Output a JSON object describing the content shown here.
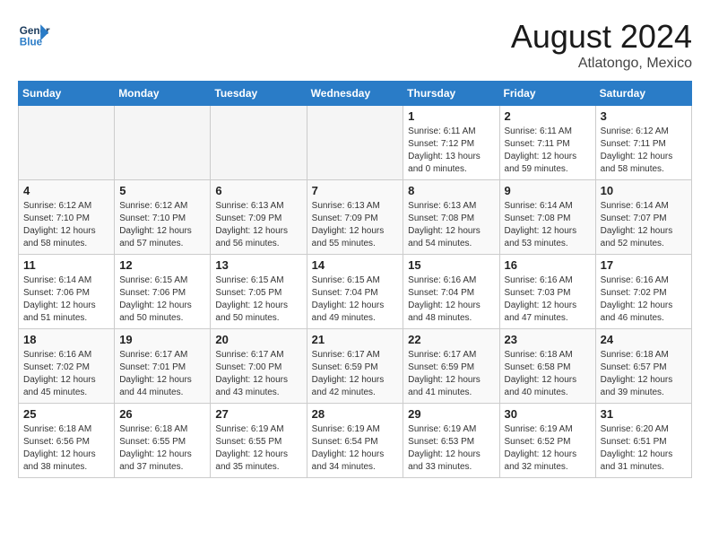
{
  "header": {
    "logo_line1": "General",
    "logo_line2": "Blue",
    "month": "August 2024",
    "location": "Atlatongo, Mexico"
  },
  "days_of_week": [
    "Sunday",
    "Monday",
    "Tuesday",
    "Wednesday",
    "Thursday",
    "Friday",
    "Saturday"
  ],
  "weeks": [
    [
      {
        "day": "",
        "info": ""
      },
      {
        "day": "",
        "info": ""
      },
      {
        "day": "",
        "info": ""
      },
      {
        "day": "",
        "info": ""
      },
      {
        "day": "1",
        "info": "Sunrise: 6:11 AM\nSunset: 7:12 PM\nDaylight: 13 hours\nand 0 minutes."
      },
      {
        "day": "2",
        "info": "Sunrise: 6:11 AM\nSunset: 7:11 PM\nDaylight: 12 hours\nand 59 minutes."
      },
      {
        "day": "3",
        "info": "Sunrise: 6:12 AM\nSunset: 7:11 PM\nDaylight: 12 hours\nand 58 minutes."
      }
    ],
    [
      {
        "day": "4",
        "info": "Sunrise: 6:12 AM\nSunset: 7:10 PM\nDaylight: 12 hours\nand 58 minutes."
      },
      {
        "day": "5",
        "info": "Sunrise: 6:12 AM\nSunset: 7:10 PM\nDaylight: 12 hours\nand 57 minutes."
      },
      {
        "day": "6",
        "info": "Sunrise: 6:13 AM\nSunset: 7:09 PM\nDaylight: 12 hours\nand 56 minutes."
      },
      {
        "day": "7",
        "info": "Sunrise: 6:13 AM\nSunset: 7:09 PM\nDaylight: 12 hours\nand 55 minutes."
      },
      {
        "day": "8",
        "info": "Sunrise: 6:13 AM\nSunset: 7:08 PM\nDaylight: 12 hours\nand 54 minutes."
      },
      {
        "day": "9",
        "info": "Sunrise: 6:14 AM\nSunset: 7:08 PM\nDaylight: 12 hours\nand 53 minutes."
      },
      {
        "day": "10",
        "info": "Sunrise: 6:14 AM\nSunset: 7:07 PM\nDaylight: 12 hours\nand 52 minutes."
      }
    ],
    [
      {
        "day": "11",
        "info": "Sunrise: 6:14 AM\nSunset: 7:06 PM\nDaylight: 12 hours\nand 51 minutes."
      },
      {
        "day": "12",
        "info": "Sunrise: 6:15 AM\nSunset: 7:06 PM\nDaylight: 12 hours\nand 50 minutes."
      },
      {
        "day": "13",
        "info": "Sunrise: 6:15 AM\nSunset: 7:05 PM\nDaylight: 12 hours\nand 50 minutes."
      },
      {
        "day": "14",
        "info": "Sunrise: 6:15 AM\nSunset: 7:04 PM\nDaylight: 12 hours\nand 49 minutes."
      },
      {
        "day": "15",
        "info": "Sunrise: 6:16 AM\nSunset: 7:04 PM\nDaylight: 12 hours\nand 48 minutes."
      },
      {
        "day": "16",
        "info": "Sunrise: 6:16 AM\nSunset: 7:03 PM\nDaylight: 12 hours\nand 47 minutes."
      },
      {
        "day": "17",
        "info": "Sunrise: 6:16 AM\nSunset: 7:02 PM\nDaylight: 12 hours\nand 46 minutes."
      }
    ],
    [
      {
        "day": "18",
        "info": "Sunrise: 6:16 AM\nSunset: 7:02 PM\nDaylight: 12 hours\nand 45 minutes."
      },
      {
        "day": "19",
        "info": "Sunrise: 6:17 AM\nSunset: 7:01 PM\nDaylight: 12 hours\nand 44 minutes."
      },
      {
        "day": "20",
        "info": "Sunrise: 6:17 AM\nSunset: 7:00 PM\nDaylight: 12 hours\nand 43 minutes."
      },
      {
        "day": "21",
        "info": "Sunrise: 6:17 AM\nSunset: 6:59 PM\nDaylight: 12 hours\nand 42 minutes."
      },
      {
        "day": "22",
        "info": "Sunrise: 6:17 AM\nSunset: 6:59 PM\nDaylight: 12 hours\nand 41 minutes."
      },
      {
        "day": "23",
        "info": "Sunrise: 6:18 AM\nSunset: 6:58 PM\nDaylight: 12 hours\nand 40 minutes."
      },
      {
        "day": "24",
        "info": "Sunrise: 6:18 AM\nSunset: 6:57 PM\nDaylight: 12 hours\nand 39 minutes."
      }
    ],
    [
      {
        "day": "25",
        "info": "Sunrise: 6:18 AM\nSunset: 6:56 PM\nDaylight: 12 hours\nand 38 minutes."
      },
      {
        "day": "26",
        "info": "Sunrise: 6:18 AM\nSunset: 6:55 PM\nDaylight: 12 hours\nand 37 minutes."
      },
      {
        "day": "27",
        "info": "Sunrise: 6:19 AM\nSunset: 6:55 PM\nDaylight: 12 hours\nand 35 minutes."
      },
      {
        "day": "28",
        "info": "Sunrise: 6:19 AM\nSunset: 6:54 PM\nDaylight: 12 hours\nand 34 minutes."
      },
      {
        "day": "29",
        "info": "Sunrise: 6:19 AM\nSunset: 6:53 PM\nDaylight: 12 hours\nand 33 minutes."
      },
      {
        "day": "30",
        "info": "Sunrise: 6:19 AM\nSunset: 6:52 PM\nDaylight: 12 hours\nand 32 minutes."
      },
      {
        "day": "31",
        "info": "Sunrise: 6:20 AM\nSunset: 6:51 PM\nDaylight: 12 hours\nand 31 minutes."
      }
    ]
  ]
}
